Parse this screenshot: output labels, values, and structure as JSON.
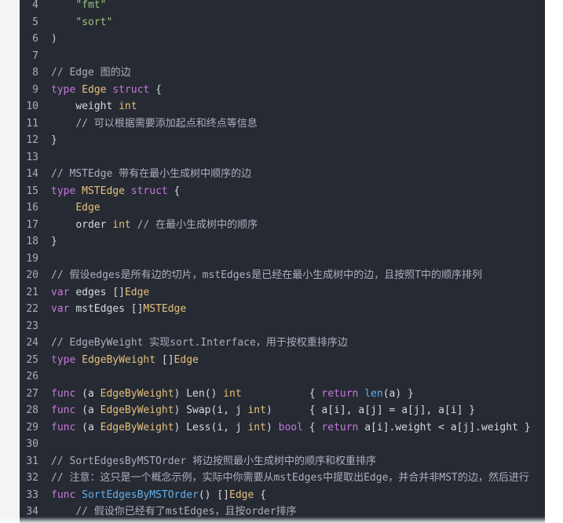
{
  "lines": [
    {
      "n": "4",
      "text": "    \"fmt\""
    },
    {
      "n": "5",
      "text": "    \"sort\""
    },
    {
      "n": "6",
      "text": ")"
    },
    {
      "n": "7",
      "text": ""
    },
    {
      "n": "8",
      "text": "// Edge 图的边"
    },
    {
      "n": "9",
      "text": "type Edge struct {"
    },
    {
      "n": "10",
      "text": "    weight int"
    },
    {
      "n": "11",
      "text": "    // 可以根据需要添加起点和终点等信息"
    },
    {
      "n": "12",
      "text": "}"
    },
    {
      "n": "13",
      "text": ""
    },
    {
      "n": "14",
      "text": "// MSTEdge 带有在最小生成树中顺序的边"
    },
    {
      "n": "15",
      "text": "type MSTEdge struct {"
    },
    {
      "n": "16",
      "text": "    Edge"
    },
    {
      "n": "17",
      "text": "    order int // 在最小生成树中的顺序"
    },
    {
      "n": "18",
      "text": "}"
    },
    {
      "n": "19",
      "text": ""
    },
    {
      "n": "20",
      "text": "// 假设edges是所有边的切片，mstEdges是已经在最小生成树中的边，且按照T中的顺序排列"
    },
    {
      "n": "21",
      "text": "var edges []Edge"
    },
    {
      "n": "22",
      "text": "var mstEdges []MSTEdge"
    },
    {
      "n": "23",
      "text": ""
    },
    {
      "n": "24",
      "text": "// EdgeByWeight 实现sort.Interface，用于按权重排序边"
    },
    {
      "n": "25",
      "text": "type EdgeByWeight []Edge"
    },
    {
      "n": "26",
      "text": ""
    },
    {
      "n": "27",
      "text": "func (a EdgeByWeight) Len() int           { return len(a) }"
    },
    {
      "n": "28",
      "text": "func (a EdgeByWeight) Swap(i, j int)      { a[i], a[j] = a[j], a[i] }"
    },
    {
      "n": "29",
      "text": "func (a EdgeByWeight) Less(i, j int) bool { return a[i].weight < a[j].weight }"
    },
    {
      "n": "30",
      "text": ""
    },
    {
      "n": "31",
      "text": "// SortEdgesByMSTOrder 将边按照最小生成树中的顺序和权重排序"
    },
    {
      "n": "32",
      "text": "// 注意：这只是一个概念示例，实际中你需要从mstEdges中提取出Edge，并合并非MST的边，然后进行"
    },
    {
      "n": "33",
      "text": "func SortEdgesByMSTOrder() []Edge {"
    },
    {
      "n": "34",
      "text": "    // 假设你已经有了mstEdges，且按order排序"
    }
  ],
  "colors": {
    "editor_bg": "#262a33",
    "page_bg": "#f3f4f6",
    "keyword": "#c678dd",
    "type": "#e5c07b",
    "string": "#98c379",
    "comment": "#aab0bc",
    "function": "#61afef",
    "text": "#d6d9de",
    "line_number": "#a9afb8"
  }
}
